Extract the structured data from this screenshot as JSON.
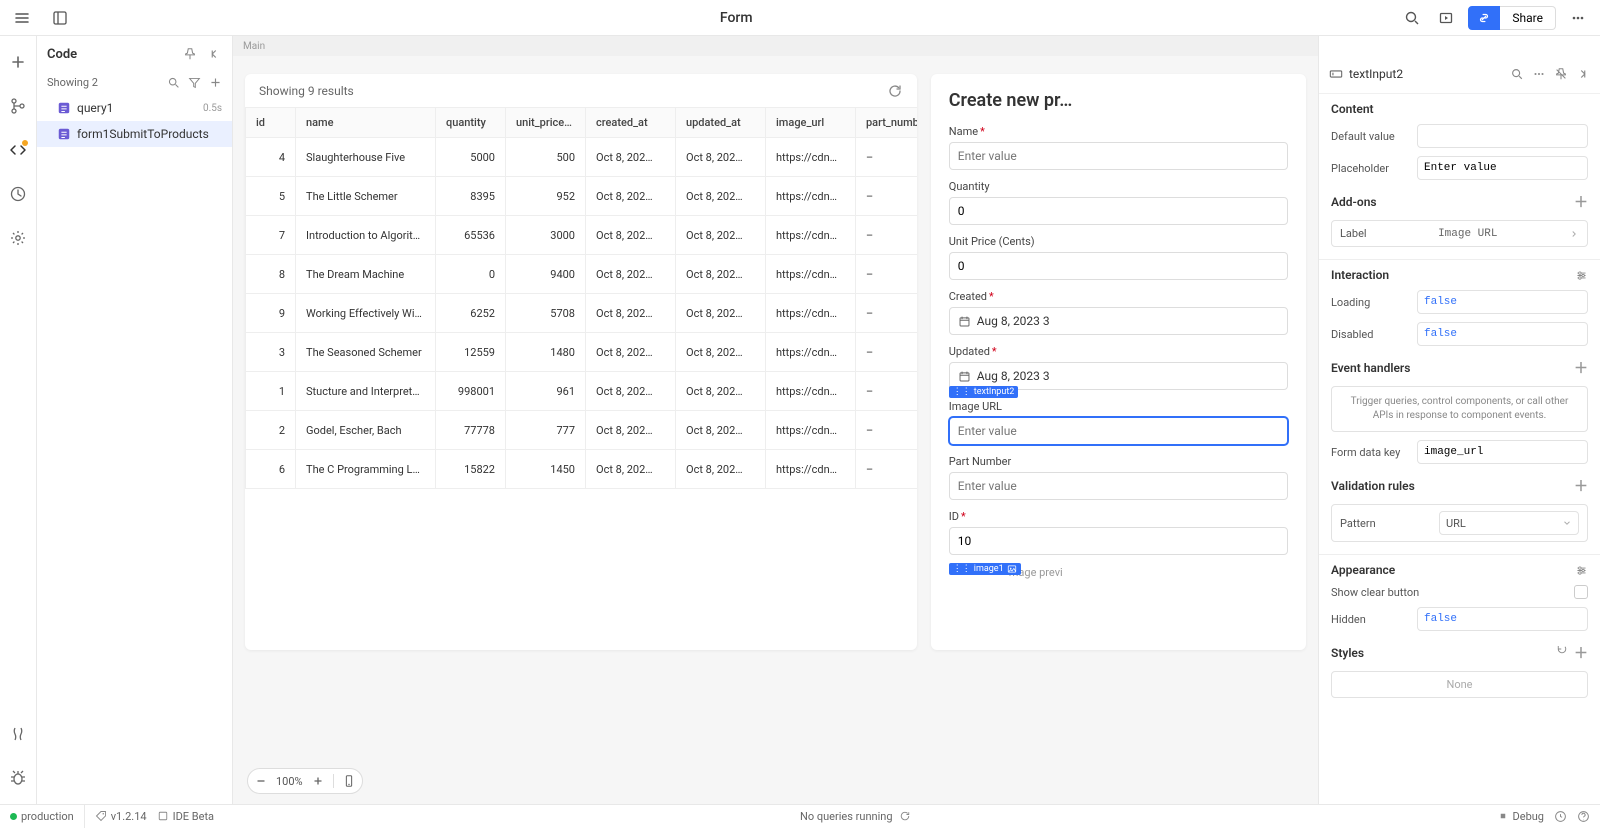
{
  "topbar": {
    "title": "Form",
    "share": "Share"
  },
  "code_panel": {
    "title": "Code",
    "showing": "Showing 2",
    "queries": [
      {
        "name": "query1",
        "time": "0.5s"
      },
      {
        "name": "form1SubmitToProducts",
        "time": ""
      }
    ]
  },
  "canvas": {
    "breadcrumb": "Main",
    "table": {
      "showing": "Showing 9 results",
      "columns": [
        "id",
        "name",
        "quantity",
        "unit_price_c...",
        "created_at",
        "updated_at",
        "image_url",
        "part_number"
      ],
      "rows": [
        {
          "id": "4",
          "name": "Slaughterhouse Five",
          "quantity": "5000",
          "unit_price": "500",
          "created_at": "Oct 8, 202…",
          "updated_at": "Oct 8, 202…",
          "image_url": "https://cdn…",
          "part_number": "–"
        },
        {
          "id": "5",
          "name": "The Little Schemer",
          "quantity": "8395",
          "unit_price": "952",
          "created_at": "Oct 8, 202…",
          "updated_at": "Oct 8, 202…",
          "image_url": "https://cdn…",
          "part_number": "–"
        },
        {
          "id": "7",
          "name": "Introduction to Algorit…",
          "quantity": "65536",
          "unit_price": "3000",
          "created_at": "Oct 8, 202…",
          "updated_at": "Oct 8, 202…",
          "image_url": "https://cdn…",
          "part_number": "–"
        },
        {
          "id": "8",
          "name": "The Dream Machine",
          "quantity": "0",
          "unit_price": "9400",
          "created_at": "Oct 8, 202…",
          "updated_at": "Oct 8, 202…",
          "image_url": "https://cdn…",
          "part_number": "–"
        },
        {
          "id": "9",
          "name": "Working Effectively Wi…",
          "quantity": "6252",
          "unit_price": "5708",
          "created_at": "Oct 8, 202…",
          "updated_at": "Oct 8, 202…",
          "image_url": "https://cdn…",
          "part_number": "–"
        },
        {
          "id": "3",
          "name": "The Seasoned Schemer",
          "quantity": "12559",
          "unit_price": "1480",
          "created_at": "Oct 8, 202…",
          "updated_at": "Oct 8, 202…",
          "image_url": "https://cdn…",
          "part_number": "–"
        },
        {
          "id": "1",
          "name": "Stucture and Interpret…",
          "quantity": "998001",
          "unit_price": "961",
          "created_at": "Oct 8, 202…",
          "updated_at": "Oct 8, 202…",
          "image_url": "https://cdn…",
          "part_number": "–"
        },
        {
          "id": "2",
          "name": "Godel, Escher, Bach",
          "quantity": "77778",
          "unit_price": "777",
          "created_at": "Oct 8, 202…",
          "updated_at": "Oct 8, 202…",
          "image_url": "https://cdn…",
          "part_number": "–"
        },
        {
          "id": "6",
          "name": "The C Programming L…",
          "quantity": "15822",
          "unit_price": "1450",
          "created_at": "Oct 8, 202…",
          "updated_at": "Oct 8, 202…",
          "image_url": "https://cdn…",
          "part_number": "–"
        }
      ]
    },
    "form": {
      "title": "Create new pr…",
      "name_label": "Name",
      "name_placeholder": "Enter value",
      "quantity_label": "Quantity",
      "quantity_value": "0",
      "unit_price_label": "Unit Price (Cents)",
      "unit_price_value": "0",
      "created_label": "Created",
      "created_value": "Aug 8, 2023   3",
      "updated_label": "Updated",
      "updated_value": "Aug 8, 2023   3",
      "image_url_label": "Image URL",
      "image_url_placeholder": "Enter value",
      "part_number_label": "Part Number",
      "part_number_placeholder": "Enter value",
      "id_label": "ID",
      "id_value": "10",
      "preview_text": "mage previ",
      "tag_textinput": "textInput2",
      "tag_image": "image1"
    },
    "zoom": "100%"
  },
  "inspector": {
    "component_name": "textInput2",
    "sections": {
      "content": "Content",
      "default_value": "Default value",
      "placeholder": "Placeholder",
      "placeholder_value": "Enter value",
      "addons": "Add-ons",
      "label_text": "Label",
      "label_value": "Image URL",
      "interaction": "Interaction",
      "loading": "Loading",
      "loading_value": "false",
      "disabled": "Disabled",
      "disabled_value": "false",
      "event_handlers": "Event handlers",
      "event_hint": "Trigger queries, control components, or call other APIs in response to component events.",
      "form_data_key": "Form data key",
      "form_data_key_value": "image_url",
      "validation_rules": "Validation rules",
      "pattern": "Pattern",
      "pattern_value": "URL",
      "appearance": "Appearance",
      "show_clear": "Show clear button",
      "hidden": "Hidden",
      "hidden_value": "false",
      "styles": "Styles",
      "styles_value": "None"
    }
  },
  "statusbar": {
    "env": "production",
    "version": "v1.2.14",
    "ide": "IDE Beta",
    "queries": "No queries running",
    "debug": "Debug"
  }
}
